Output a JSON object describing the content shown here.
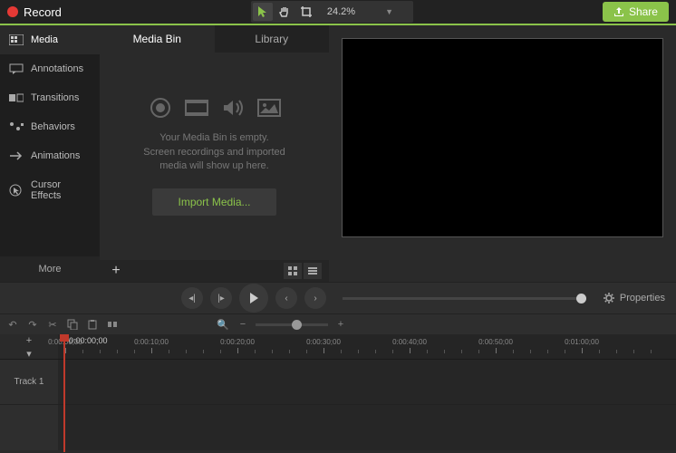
{
  "topbar": {
    "record_label": "Record",
    "zoom_value": "24.2%",
    "share_label": "Share"
  },
  "sidebar": {
    "items": [
      {
        "label": "Media",
        "icon": "media"
      },
      {
        "label": "Annotations",
        "icon": "annotations"
      },
      {
        "label": "Transitions",
        "icon": "transitions"
      },
      {
        "label": "Behaviors",
        "icon": "behaviors"
      },
      {
        "label": "Animations",
        "icon": "animations"
      },
      {
        "label": "Cursor Effects",
        "icon": "cursor"
      }
    ],
    "more_label": "More"
  },
  "bin": {
    "tabs": [
      {
        "label": "Media Bin"
      },
      {
        "label": "Library"
      }
    ],
    "empty_line1": "Your Media Bin is empty.",
    "empty_line2": "Screen recordings and imported",
    "empty_line3": "media will show up here.",
    "import_label": "Import Media..."
  },
  "playback": {
    "properties_label": "Properties"
  },
  "timeline": {
    "current_time": "0:00:00;00",
    "ticks": [
      "0:00:00;00",
      "0:00:10;00",
      "0:00:20;00",
      "0:00:30;00",
      "0:00:40;00",
      "0:00:50;00",
      "0:01:00;00"
    ],
    "tracks": [
      {
        "label": "Track 1"
      }
    ]
  }
}
